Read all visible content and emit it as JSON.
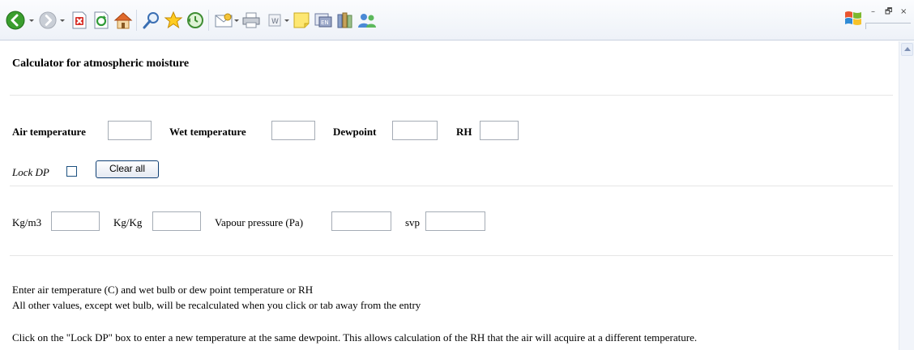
{
  "toolbar": {
    "buttons": [
      "back-icon",
      "forward-icon",
      "stop-icon",
      "refresh-icon",
      "home-icon",
      "search-icon",
      "favorites-icon",
      "history-icon",
      "mail-icon",
      "print-icon",
      "edit-icon",
      "notes-icon",
      "messenger-icon",
      "research-icon",
      "contacts-icon"
    ]
  },
  "page": {
    "title": "Calculator for atmospheric moisture",
    "row1": {
      "air_temperature_label": "Air temperature",
      "air_temperature_value": "",
      "wet_temperature_label": "Wet temperature",
      "wet_temperature_value": "",
      "dewpoint_label": "Dewpoint",
      "dewpoint_value": "",
      "rh_label": "RH",
      "rh_value": ""
    },
    "lock_dp_label": "Lock DP",
    "clear_all_label": "Clear all",
    "row2": {
      "kg_m3_label": "Kg/m3",
      "kg_m3_value": "",
      "kg_kg_label": "Kg/Kg",
      "kg_kg_value": "",
      "vapour_pressure_label": "Vapour pressure (Pa)",
      "vapour_pressure_value": "",
      "svp_label": "svp",
      "svp_value": ""
    },
    "notes": [
      "Enter air temperature (C) and wet bulb or dew point temperature or RH",
      "All other values, except wet bulb, will be recalculated when you click or tab away from the entry",
      "Click on the \"Lock DP\" box to enter a new temperature at the same dewpoint. This allows calculation of the RH that the air will acquire at a different temperature."
    ]
  },
  "window": {
    "minimize": "–",
    "restore": "🗗",
    "close": "×"
  }
}
